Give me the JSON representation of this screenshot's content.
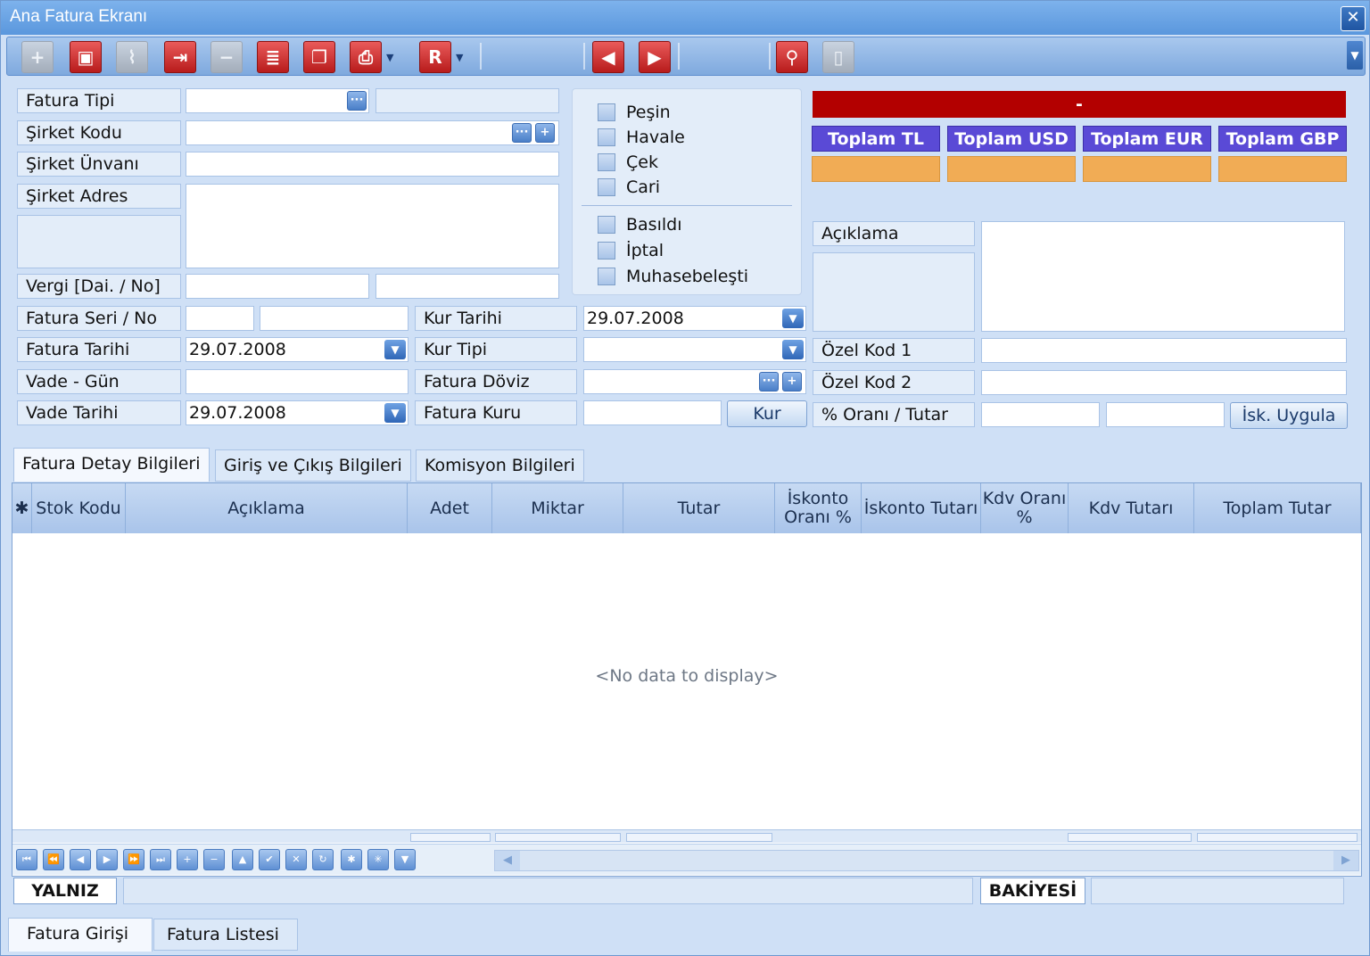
{
  "window": {
    "title": "Ana Fatura Ekranı",
    "close_glyph": "✕"
  },
  "toolbar": {
    "buttons": [
      {
        "icon": "add-icon",
        "glyph": "+"
      },
      {
        "icon": "save-icon",
        "glyph": "▣"
      },
      {
        "icon": "attach-icon",
        "glyph": "⌇"
      },
      {
        "icon": "export-icon",
        "glyph": "⇥"
      },
      {
        "icon": "delete-icon",
        "glyph": "−"
      },
      {
        "icon": "document-icon",
        "glyph": "≣"
      },
      {
        "icon": "copy-icon",
        "glyph": "❐"
      },
      {
        "icon": "print-icon",
        "glyph": "⎙"
      },
      {
        "icon": "report-icon",
        "glyph": "R"
      },
      {
        "icon": "previous-icon",
        "glyph": "◀"
      },
      {
        "icon": "next-icon",
        "glyph": "▶"
      },
      {
        "icon": "find-icon",
        "glyph": "⚲"
      },
      {
        "icon": "exit-icon",
        "glyph": "▯"
      }
    ]
  },
  "form": {
    "fatura_tipi_label": "Fatura Tipi",
    "sirket_kodu_label": "Şirket Kodu",
    "sirket_unvani_label": "Şirket Ünvanı",
    "sirket_adres_label": "Şirket Adres",
    "vergi_label": "Vergi [Dai. / No]",
    "fatura_seri_no_label": "Fatura Seri / No",
    "fatura_tarihi_label": "Fatura Tarihi",
    "fatura_tarihi_value": "29.07.2008",
    "vade_gun_label": "Vade - Gün",
    "vade_tarihi_label": "Vade Tarihi",
    "vade_tarihi_value": "29.07.2008",
    "kur_tarihi_label": "Kur Tarihi",
    "kur_tarihi_value": "29.07.2008",
    "kur_tipi_label": "Kur Tipi",
    "fatura_doviz_label": "Fatura Döviz",
    "fatura_kuru_label": "Fatura Kuru",
    "kur_button": "Kur",
    "ellipsis": "···",
    "plus": "+"
  },
  "checkboxes": {
    "payment": [
      "Peşin",
      "Havale",
      "Çek",
      "Cari"
    ],
    "status": [
      "Basıldı",
      "İptal",
      "Muhasebeleşti"
    ]
  },
  "summary": {
    "status_text": "-",
    "totals": [
      "Toplam TL",
      "Toplam USD",
      "Toplam EUR",
      "Toplam GBP"
    ],
    "colors": {
      "status": "#b30000",
      "total_header": "#5a4ad6",
      "total_value": "#f1ac55"
    }
  },
  "right_form": {
    "aciklama_label": "Açıklama",
    "ozel_kod_1_label": "Özel Kod 1",
    "ozel_kod_2_label": "Özel Kod 2",
    "oran_tutar_label": "% Oranı / Tutar",
    "isk_uygula_button": "İsk. Uygula"
  },
  "detail_tabs": [
    "Fatura Detay Bilgileri",
    "Giriş ve Çıkış Bilgileri",
    "Komisyon Bilgileri"
  ],
  "grid": {
    "indicator": "✱",
    "columns": [
      "Stok Kodu",
      "Açıklama",
      "Adet",
      "Miktar",
      "Tutar",
      "İskonto Oranı %",
      "İskonto Tutarı",
      "Kdv Oranı %",
      "Kdv Tutarı",
      "Toplam Tutar"
    ],
    "empty_text": "<No data to display>",
    "nav_buttons": [
      {
        "icon": "first-page-icon",
        "glyph": "⏮"
      },
      {
        "icon": "prev-page-icon",
        "glyph": "⏪"
      },
      {
        "icon": "prev-record-icon",
        "glyph": "◀"
      },
      {
        "icon": "next-record-icon",
        "glyph": "▶"
      },
      {
        "icon": "next-page-icon",
        "glyph": "⏩"
      },
      {
        "icon": "last-page-icon",
        "glyph": "⏭"
      },
      {
        "icon": "append-icon",
        "glyph": "+"
      },
      {
        "icon": "remove-icon",
        "glyph": "−"
      },
      {
        "icon": "edit-icon",
        "glyph": "▲"
      },
      {
        "icon": "post-icon",
        "glyph": "✔"
      },
      {
        "icon": "cancel-icon",
        "glyph": "✕"
      },
      {
        "icon": "refresh-icon",
        "glyph": "↻"
      },
      {
        "icon": "bookmark-icon",
        "glyph": "✱"
      },
      {
        "icon": "goto-bookmark-icon",
        "glyph": "✳"
      },
      {
        "icon": "filter-icon",
        "glyph": "▼"
      }
    ],
    "scroll_left": "◀",
    "scroll_right": "▶"
  },
  "footer": {
    "yalniz_label": "YALNIZ",
    "bakiyesi_label": "BAKİYESİ"
  },
  "bottom_tabs": [
    "Fatura Girişi",
    "Fatura Listesi"
  ]
}
